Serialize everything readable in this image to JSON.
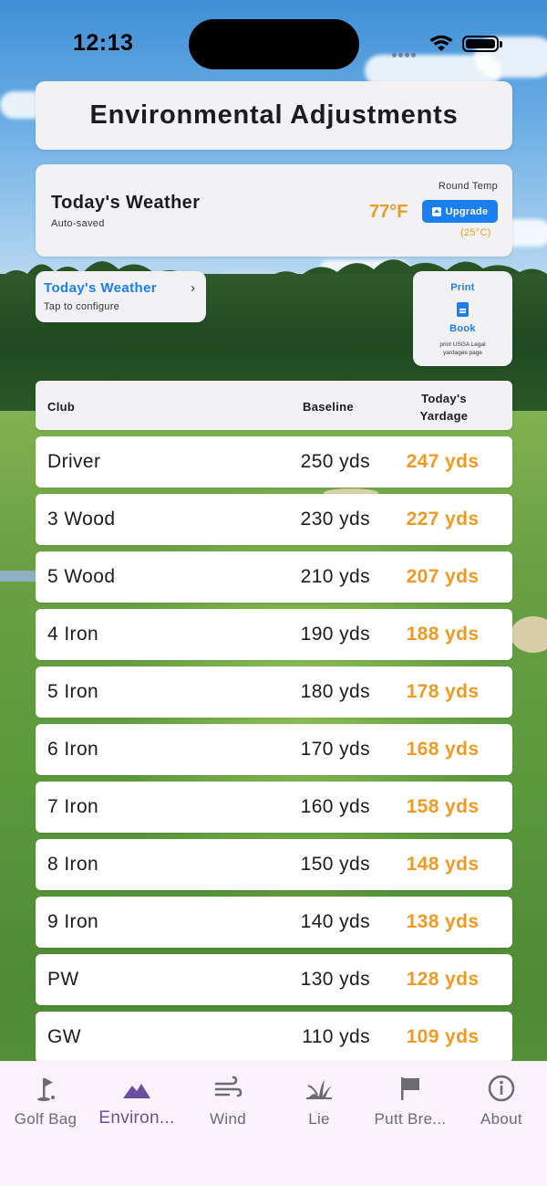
{
  "status_bar": {
    "time": "12:13"
  },
  "header": {
    "title": "Environmental Adjustments"
  },
  "weather": {
    "title": "Today's Weather",
    "subtitle": "Auto-saved",
    "round_temp_label": "Round Temp",
    "temp_f": "77°F",
    "upgrade_label": "Upgrade",
    "temp_c": "(25°C)"
  },
  "config": {
    "title": "Today's Weather",
    "subtitle": "Tap to configure"
  },
  "print": {
    "print_label": "Print",
    "book_label": "Book",
    "note": "print USGA Legal yardages page"
  },
  "table": {
    "headers": {
      "club": "Club",
      "baseline": "Baseline",
      "today": "Today's Yardage"
    },
    "rows": [
      {
        "club": "Driver",
        "baseline": "250 yds",
        "today": "247 yds"
      },
      {
        "club": "3 Wood",
        "baseline": "230 yds",
        "today": "227 yds"
      },
      {
        "club": "5 Wood",
        "baseline": "210 yds",
        "today": "207 yds"
      },
      {
        "club": "4 Iron",
        "baseline": "190 yds",
        "today": "188 yds"
      },
      {
        "club": "5 Iron",
        "baseline": "180 yds",
        "today": "178 yds"
      },
      {
        "club": "6 Iron",
        "baseline": "170 yds",
        "today": "168 yds"
      },
      {
        "club": "7 Iron",
        "baseline": "160 yds",
        "today": "158 yds"
      },
      {
        "club": "8 Iron",
        "baseline": "150 yds",
        "today": "148 yds"
      },
      {
        "club": "9 Iron",
        "baseline": "140 yds",
        "today": "138 yds"
      },
      {
        "club": "PW",
        "baseline": "130 yds",
        "today": "128 yds"
      },
      {
        "club": "GW",
        "baseline": "110 yds",
        "today": "109 yds"
      }
    ]
  },
  "tabs": [
    {
      "label": "Golf Bag",
      "icon": "golf-flag-icon",
      "active": false
    },
    {
      "label": "Environ...",
      "icon": "mountains-icon",
      "active": true
    },
    {
      "label": "Wind",
      "icon": "wind-icon",
      "active": false
    },
    {
      "label": "Lie",
      "icon": "grass-icon",
      "active": false
    },
    {
      "label": "Putt Bre...",
      "icon": "flag-icon",
      "active": false
    },
    {
      "label": "About",
      "icon": "info-icon",
      "active": false
    }
  ],
  "colors": {
    "accent_orange": "#f19a1f",
    "accent_blue": "#1a7ff0",
    "active_tab": "#6a4fa3"
  }
}
